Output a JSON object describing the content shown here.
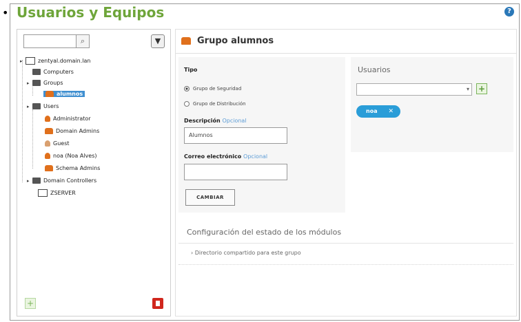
{
  "page": {
    "bullet": "•",
    "title": "Usuarios y Equipos",
    "help_icon": "?"
  },
  "tree_panel": {
    "search_value": "",
    "search_icon": "magnifier-icon",
    "filter_icon": "funnel-icon",
    "nodes": [
      {
        "label": "zentyal.domain.lan",
        "icon": "server-icon",
        "level": 0,
        "selected": false
      },
      {
        "label": "Computers",
        "icon": "folder-icon",
        "level": 1,
        "selected": false
      },
      {
        "label": "Groups",
        "icon": "folder-icon",
        "level": 1,
        "selected": false
      },
      {
        "label": "alumnos",
        "icon": "group-icon",
        "level": 2,
        "selected": true
      },
      {
        "label": "Users",
        "icon": "folder-icon",
        "level": 1,
        "selected": false
      },
      {
        "label": "Administrator",
        "icon": "user-icon",
        "level": 2,
        "selected": false
      },
      {
        "label": "Domain Admins",
        "icon": "group-icon",
        "level": 2,
        "selected": false
      },
      {
        "label": "Guest",
        "icon": "user-icon",
        "level": 2,
        "selected": false
      },
      {
        "label": "noa (Noa Alves)",
        "icon": "user-icon",
        "level": 2,
        "selected": false
      },
      {
        "label": "Schema Admins",
        "icon": "group-icon",
        "level": 2,
        "selected": false
      },
      {
        "label": "Domain Controllers",
        "icon": "folder-icon",
        "level": 1,
        "selected": false
      },
      {
        "label": "ZSERVER",
        "icon": "computer-icon",
        "level": 2,
        "selected": false
      }
    ],
    "add_label": "+"
  },
  "group": {
    "title": "Grupo alumnos",
    "tipo_label": "Tipo",
    "option_security": "Grupo de Seguridad",
    "option_distribution": "Grupo de Distribución",
    "selected_type": "security",
    "description_label": "Descripción",
    "optional_label": "Opcional",
    "description_value": "Alumnos",
    "email_label": "Correo electrónico",
    "email_value": "",
    "change_button": "CAMBIAR"
  },
  "users": {
    "label": "Usuarios",
    "combo_value": "",
    "add_label": "+",
    "members": [
      {
        "name": "noa",
        "remove": "✕"
      }
    ]
  },
  "modules": {
    "title": "Configuración del estado de los módulos",
    "items": [
      "Directorio compartido para este grupo"
    ],
    "expand_icon": "›"
  },
  "colors": {
    "title_green": "#6ea53a",
    "selection_blue": "#3f8fd0",
    "tag_blue": "#2a9dd8",
    "group_orange": "#e0701c",
    "delete_red": "#d0261d"
  }
}
